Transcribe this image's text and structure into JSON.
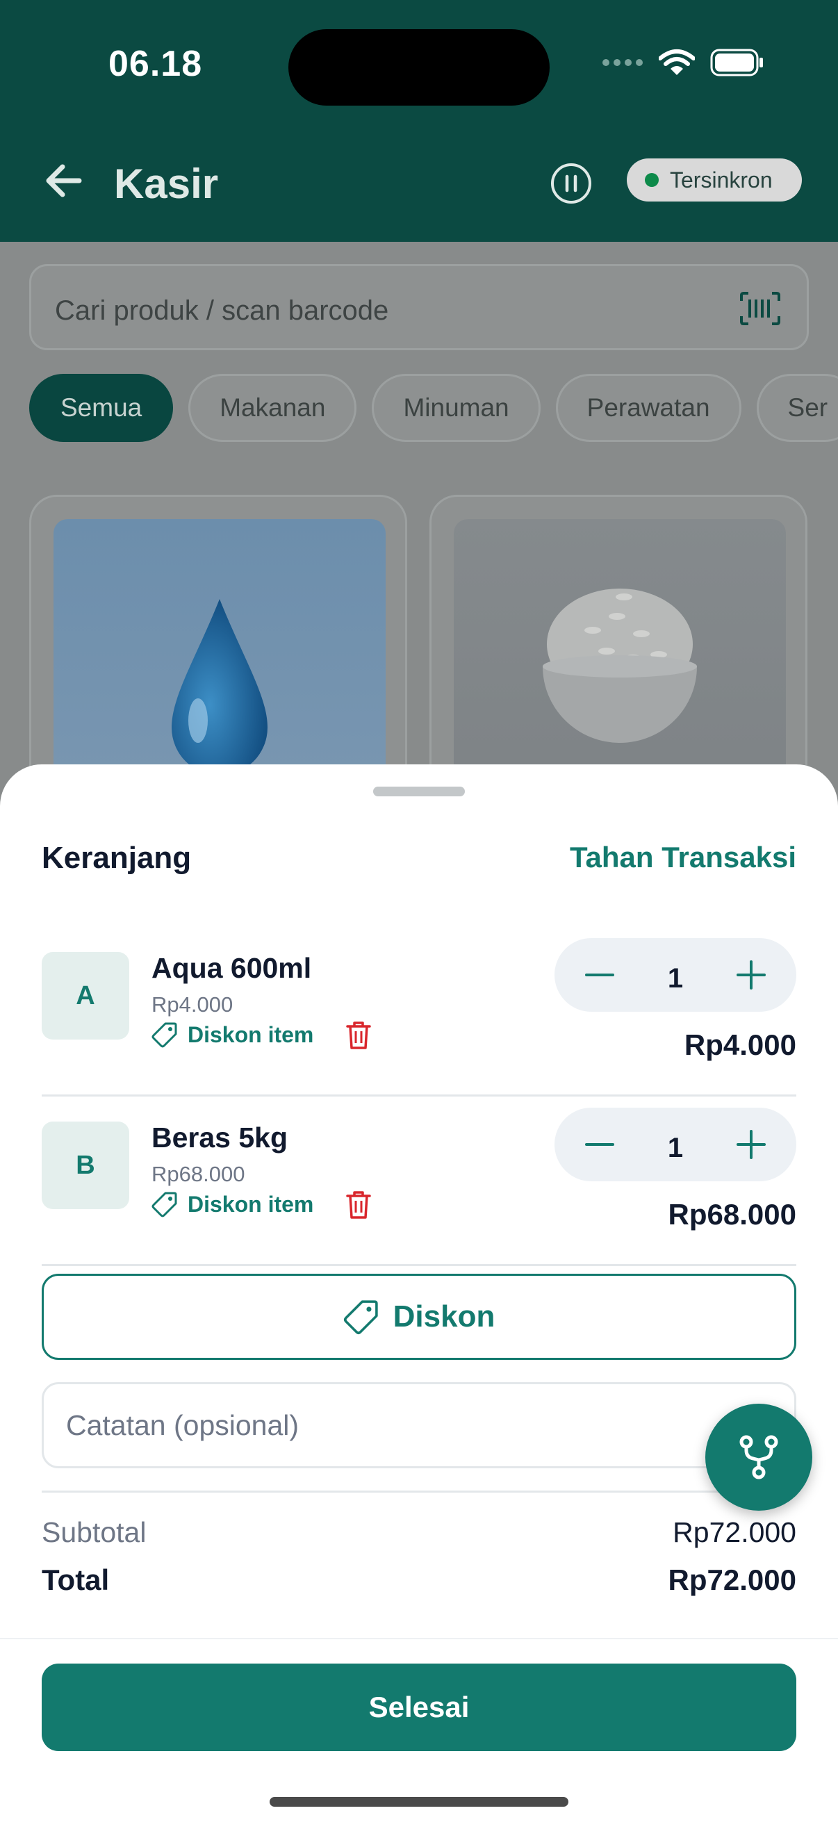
{
  "status_bar": {
    "time": "06.18"
  },
  "header": {
    "title": "Kasir",
    "sync_status": "Tersinkron"
  },
  "search": {
    "placeholder": "Cari produk / scan barcode"
  },
  "categories": [
    "Semua",
    "Makanan",
    "Minuman",
    "Perawatan",
    "Ser"
  ],
  "cart": {
    "title": "Keranjang",
    "hold_label": "Tahan Transaksi",
    "items": [
      {
        "initial": "A",
        "name": "Aqua 600ml",
        "unit_price": "Rp4.000",
        "discount_label": "Diskon item",
        "qty": "1",
        "line_total": "Rp4.000"
      },
      {
        "initial": "B",
        "name": "Beras 5kg",
        "unit_price": "Rp68.000",
        "discount_label": "Diskon item",
        "qty": "1",
        "line_total": "Rp68.000"
      }
    ],
    "discount_button": "Diskon",
    "note_placeholder": "Catatan (opsional)",
    "subtotal_label": "Subtotal",
    "subtotal_value": "Rp72.000",
    "total_label": "Total",
    "total_value": "Rp72.000",
    "finish_button": "Selesai"
  },
  "colors": {
    "header_bg": "#0b4a42",
    "accent": "#137a6e",
    "danger": "#d9262c"
  }
}
